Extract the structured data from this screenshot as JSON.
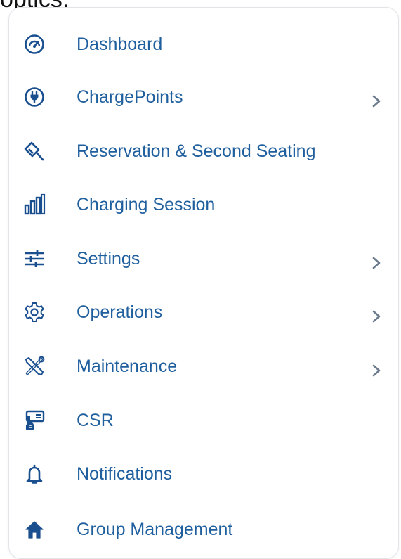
{
  "header_fragment": "optics.",
  "menu": {
    "items": [
      {
        "label": "Dashboard",
        "icon": "speedometer-icon",
        "has_submenu": false
      },
      {
        "label": "ChargePoints",
        "icon": "plug-icon",
        "has_submenu": true
      },
      {
        "label": "Reservation & Second Seating",
        "icon": "bookmark-pen-icon",
        "has_submenu": false
      },
      {
        "label": "Charging Session",
        "icon": "bar-chart-icon",
        "has_submenu": false
      },
      {
        "label": "Settings",
        "icon": "sliders-icon",
        "has_submenu": true
      },
      {
        "label": "Operations",
        "icon": "gear-icon",
        "has_submenu": true
      },
      {
        "label": "Maintenance",
        "icon": "tools-icon",
        "has_submenu": true
      },
      {
        "label": "CSR",
        "icon": "terminal-hand-icon",
        "has_submenu": false
      },
      {
        "label": "Notifications",
        "icon": "bell-icon",
        "has_submenu": false
      },
      {
        "label": "Group Management",
        "icon": "home-icon",
        "has_submenu": false
      }
    ]
  },
  "colors": {
    "label": "#1f5f9e",
    "icon": "#1a4f8f",
    "chevron": "#6b7a8c",
    "card_border": "#e2e4e8"
  }
}
